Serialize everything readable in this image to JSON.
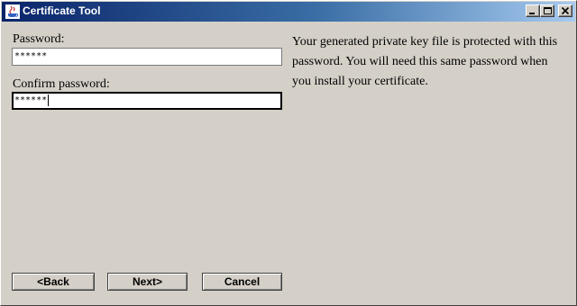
{
  "window": {
    "title": "Certificate Tool",
    "icon": "java-cup-icon",
    "controls": [
      "minimize-icon",
      "maximize-icon",
      "close-icon"
    ]
  },
  "form": {
    "password_label": "Password:",
    "password_value": "******",
    "confirm_label": "Confirm password:",
    "confirm_value": "******"
  },
  "info_text": "Your generated private key file is protected with this password.  You will need this same password when you install your certificate.",
  "buttons": {
    "back": "<Back",
    "next": "Next>",
    "cancel": "Cancel"
  },
  "colors": {
    "window_bg": "#d4d0c8",
    "titlebar_start": "#0a246a",
    "titlebar_end": "#a6caf0"
  }
}
